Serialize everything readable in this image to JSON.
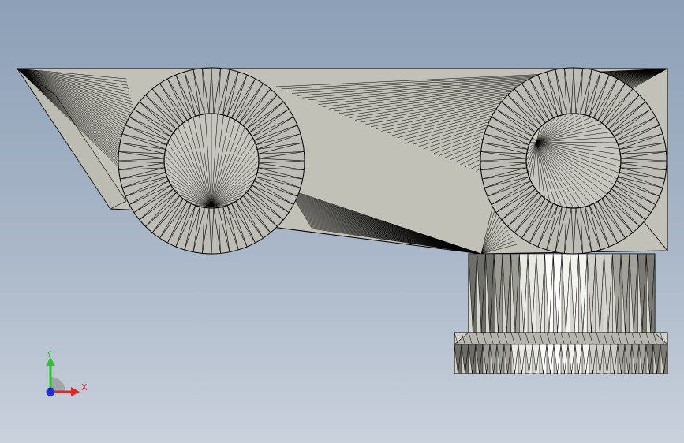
{
  "viewport": {
    "background_top": "#8da0b7",
    "background_bottom": "#c9d1dc"
  },
  "model": {
    "body_fill": "#c2c1b8",
    "wire_color": "#000000",
    "boss_fill": "#b9b9b2",
    "bore_fill": "#c7c6bf"
  },
  "triad": {
    "x_label": "X",
    "y_label": "Y",
    "x_color": "#e52521",
    "y_color": "#2fc22f",
    "z_color": "#1f2fd8"
  }
}
